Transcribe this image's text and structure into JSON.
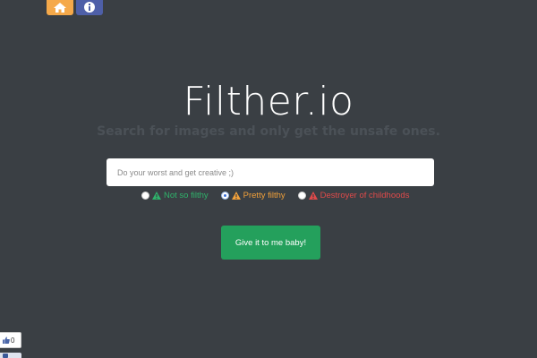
{
  "nav": {
    "home_icon": "home-icon",
    "info_icon": "info-icon",
    "home_color": "#f5a94a",
    "info_color": "#4e5fa8"
  },
  "header": {
    "title": "Filther.io",
    "subtitle": "Search for images and only get the unsafe ones."
  },
  "search": {
    "placeholder": "Do your worst and get creative ;)",
    "value": ""
  },
  "filter_options": [
    {
      "label": "Not so filthy",
      "color": "#2fb36b",
      "selected": false
    },
    {
      "label": "Pretty filthy",
      "color": "#f2a13a",
      "selected": true
    },
    {
      "label": "Destroyer of childhoods",
      "color": "#e04a4a",
      "selected": false
    }
  ],
  "submit": {
    "label": "Give it to me baby!"
  },
  "like_widget": {
    "icon": "thumbs-up-icon",
    "count": "0"
  },
  "colors": {
    "background": "#3a3f44",
    "button": "#24a05c"
  }
}
